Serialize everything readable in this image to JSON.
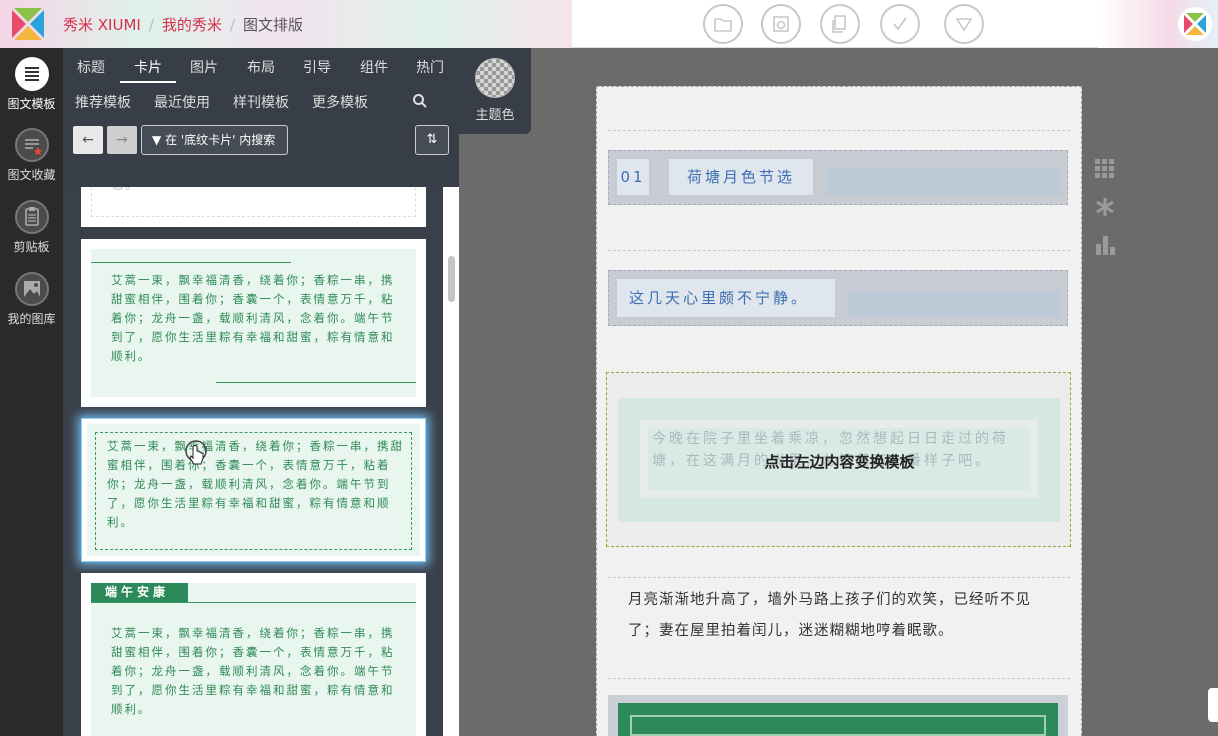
{
  "breadcrumb": {
    "brand": "秀米 XIUMI",
    "my": "我的秀米",
    "current": "图文排版"
  },
  "toolbar_icons": [
    "folder-icon",
    "preview-icon",
    "copy-icon",
    "check-icon",
    "download-icon"
  ],
  "sidebar": {
    "items": [
      {
        "label": "图文模板",
        "icon": "list-icon",
        "active": true
      },
      {
        "label": "图文收藏",
        "icon": "star-list-icon",
        "active": false
      },
      {
        "label": "剪贴板",
        "icon": "clipboard-icon",
        "active": false
      },
      {
        "label": "我的图库",
        "icon": "image-icon",
        "active": false
      }
    ]
  },
  "tabs": [
    "标题",
    "卡片",
    "图片",
    "布局",
    "引导",
    "组件",
    "热门"
  ],
  "active_tab": "卡片",
  "subtabs": [
    "推荐模板",
    "最近使用",
    "样刊模板",
    "更多模板"
  ],
  "filter_label": "在 '底纹卡片' 内搜索",
  "theme": {
    "label": "主题色"
  },
  "cards": {
    "top_partial": "恩。",
    "card1": "艾蒿一束，飘幸福清香，绕着你；香粽一串，携甜蜜相伴，围着你；香囊一个，表情意万千，粘着你；龙舟一盏，载顺利清风，念着你。端午节到了，愿你生活里粽有幸福和甜蜜，粽有情意和顺利。",
    "card2": "艾蒿一束，飘幸福清香，绕着你；香粽一串，携甜蜜相伴，围着你；香囊一个，表情意万千，粘着你；龙舟一盏，载顺利清风，念着你。端午节到了，愿你生活里粽有幸福和甜蜜，粽有情意和顺利。",
    "card3_title": "端午安康",
    "card3": "艾蒿一束，飘幸福清香，绕着你；香粽一串，携甜蜜相伴，围着你；香囊一个，表情意万千，粘着你；龙舟一盏，载顺利清风，念着你。端午节到了，愿你生活里粽有幸福和甜蜜，粽有情意和顺利。"
  },
  "editor": {
    "num": "01",
    "title1": "荷塘月色节选",
    "title2": "这几天心里颇不宁静。",
    "ghost_text": "今晚在院子里坐着乘凉，忽然想起日日走过的荷塘，在这满月的光里，总该另有一番样子吧。",
    "replace_hint": "点击左边内容变换模板",
    "body": "月亮渐渐地升高了，墙外马路上孩子们的欢笑，已经听不见了；妻在屋里拍着闰儿，迷迷糊糊地哼着眠歌。"
  },
  "colors": {
    "brand_red": "#d6314b",
    "green": "#2f8a56",
    "title_blue": "#3f6fb0"
  }
}
